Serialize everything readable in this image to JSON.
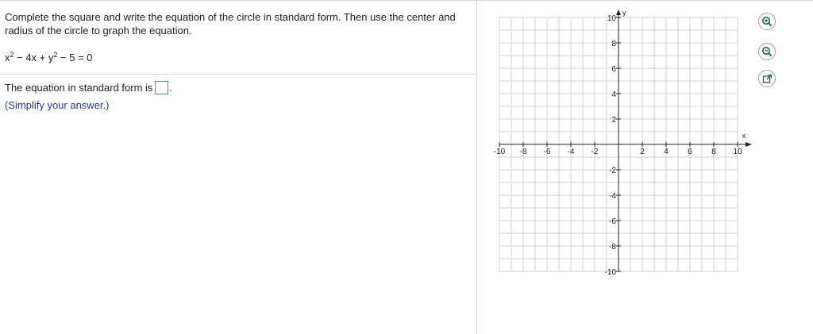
{
  "question": {
    "instructions": "Complete the square and write the equation of the circle in standard form.  Then use the center and radius of the circle to graph the equation.",
    "equation": {
      "t1": "x",
      "s1": "2",
      "t2": " − 4x + y",
      "s2": "2",
      "t3": " − 5 = 0"
    },
    "answer_prefix": "The equation in standard form is",
    "answer_suffix": ".",
    "hint": "(Simplify your answer.)"
  },
  "graph": {
    "x_label": "x",
    "y_label": "y",
    "x_ticks": [
      "-10",
      "-8",
      "-6",
      "-4",
      "-2",
      "2",
      "4",
      "6",
      "8",
      "10"
    ],
    "y_ticks": [
      "10",
      "8",
      "6",
      "4",
      "2",
      "-2",
      "-4",
      "-6",
      "-8",
      "-10"
    ],
    "range": {
      "xmin": -10,
      "xmax": 10,
      "ymin": -10,
      "ymax": 10
    },
    "grid_step": 1,
    "grid_color": "#cfcfcf",
    "axis_color": "#222222"
  },
  "tools": [
    {
      "name": "zoom-in-icon"
    },
    {
      "name": "zoom-out-icon"
    },
    {
      "name": "popout-icon"
    }
  ]
}
